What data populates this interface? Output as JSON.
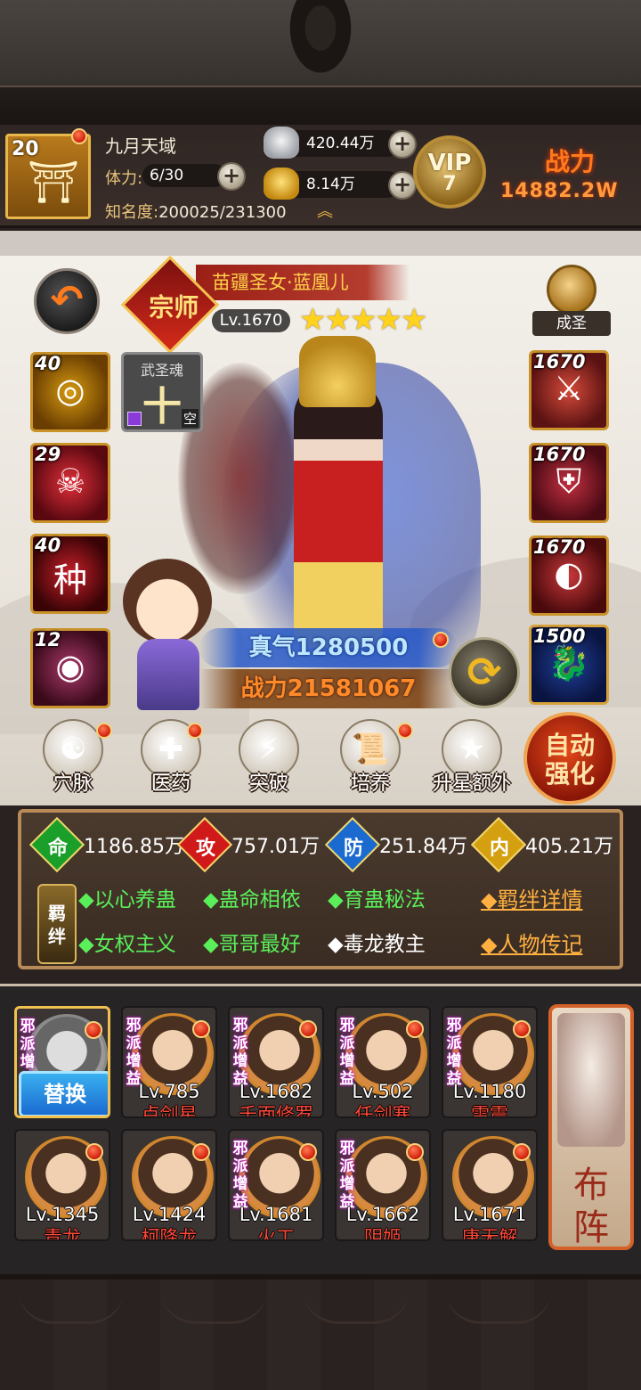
{
  "header": {
    "level": "20",
    "player_name": "九月天域",
    "stamina_label": "体力:",
    "stamina_value": "6/30",
    "fame_label": "知名度:",
    "fame_value": "200025/231300",
    "silver": "420.44万",
    "gold": "8.14万",
    "vip_label": "VIP",
    "vip_level": "7",
    "power_label": "战力",
    "power_value": "14882.2W"
  },
  "hero": {
    "grade": "宗师",
    "name": "苗疆圣女·蓝凰儿",
    "level": "Lv.1670",
    "stars": 5,
    "rank_label": "成圣",
    "qi": "真气1280500",
    "power": "战力21581067"
  },
  "equipment_left": [
    {
      "num": "40",
      "glyph": "◎"
    },
    {
      "num": "29",
      "glyph": "☠"
    },
    {
      "num": "40",
      "glyph": "种"
    },
    {
      "num": "12",
      "glyph": "◉"
    }
  ],
  "equipment_right": [
    {
      "num": "1670",
      "glyph": "⚔"
    },
    {
      "num": "1670",
      "glyph": "⛨"
    },
    {
      "num": "1670",
      "glyph": "◐"
    },
    {
      "num": "1500",
      "glyph": "🐉"
    }
  ],
  "soul_slot": {
    "title": "武圣魂",
    "char": "十",
    "empty": "空"
  },
  "functions": [
    {
      "label": "穴脉",
      "icon": "☯"
    },
    {
      "label": "医药",
      "icon": "✚"
    },
    {
      "label": "突破",
      "icon": "⚡"
    },
    {
      "label": "培养",
      "icon": "📜"
    },
    {
      "label": "升星额外",
      "icon": "★"
    }
  ],
  "auto_button": {
    "line1": "自动",
    "line2": "强化"
  },
  "stats": [
    {
      "key": "命",
      "value": "1186.85万",
      "color": "#1aa02a"
    },
    {
      "key": "攻",
      "value": "757.01万",
      "color": "#d01a1a"
    },
    {
      "key": "防",
      "value": "251.84万",
      "color": "#1a6ad0"
    },
    {
      "key": "内",
      "value": "405.21万",
      "color": "#d4a010"
    }
  ],
  "bonds": {
    "badge": "羁绊",
    "row1": [
      "◆以心养蛊",
      "◆蛊命相依",
      "◆育蛊秘法"
    ],
    "row2_on": [
      "◆女权主义",
      "◆哥哥最好"
    ],
    "row2_off": "◆毒龙教主",
    "link1": "◆羁绊详情",
    "link2": "◆人物传记"
  },
  "lineup": {
    "replace_label": "替换",
    "tag": "邪派增益",
    "formation_label": [
      "布",
      "阵"
    ],
    "members": [
      {
        "level": "",
        "name": ""
      },
      {
        "level": "Lv.785",
        "name": "卢剑星"
      },
      {
        "level": "Lv.1682",
        "name": "千面修罗"
      },
      {
        "level": "Lv.502",
        "name": "任剑寒"
      },
      {
        "level": "Lv.1180",
        "name": "雷震"
      },
      {
        "level": "Lv.1345",
        "name": "青龙"
      },
      {
        "level": "Lv.1424",
        "name": "柯降龙"
      },
      {
        "level": "Lv.1681",
        "name": "火工"
      },
      {
        "level": "Lv.1662",
        "name": "阴姬"
      },
      {
        "level": "Lv.1671",
        "name": "唐无解"
      }
    ]
  }
}
